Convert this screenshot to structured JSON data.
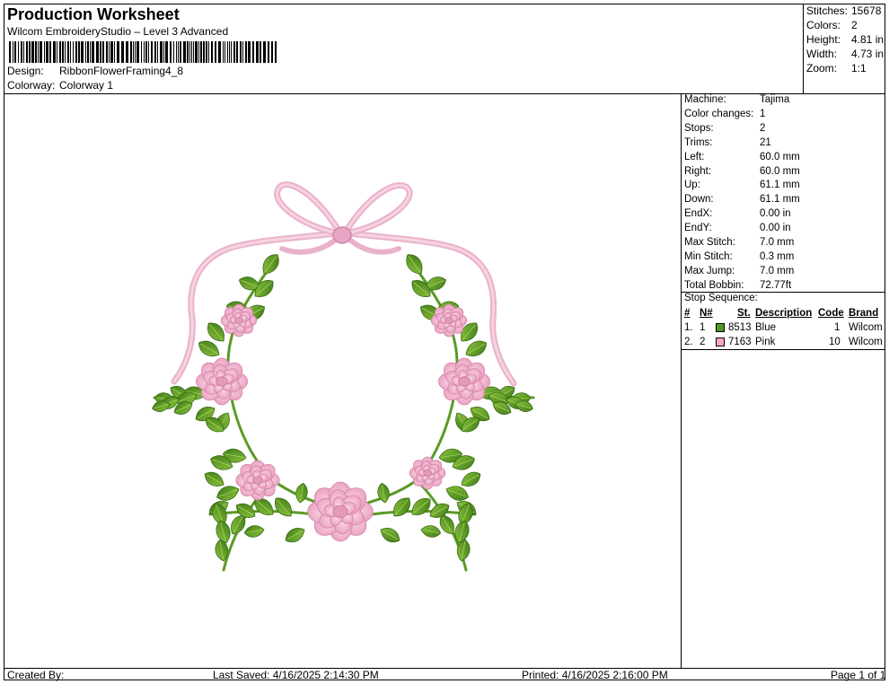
{
  "header": {
    "title": "Production Worksheet",
    "subtitle": "Wilcom EmbroideryStudio – Level 3 Advanced",
    "design_label": "Design:",
    "design_value": "RibbonFlowerFraming4_8",
    "colorway_label": "Colorway:",
    "colorway_value": "Colorway 1"
  },
  "stats": [
    {
      "label": "Stitches:",
      "value": "15678"
    },
    {
      "label": "Colors:",
      "value": "2"
    },
    {
      "label": "Height:",
      "value": "4.81 in"
    },
    {
      "label": "Width:",
      "value": "4.73 in"
    },
    {
      "label": "Zoom:",
      "value": "1:1"
    }
  ],
  "machine_info": [
    {
      "label": "Machine:",
      "value": "Tajima"
    },
    {
      "label": "Color changes:",
      "value": "1"
    },
    {
      "label": "Stops:",
      "value": "2"
    },
    {
      "label": "Trims:",
      "value": "21"
    },
    {
      "label": "Left:",
      "value": "60.0 mm"
    },
    {
      "label": "Right:",
      "value": "60.0 mm"
    },
    {
      "label": "Up:",
      "value": "61.1 mm"
    },
    {
      "label": "Down:",
      "value": "61.1 mm"
    },
    {
      "label": "EndX:",
      "value": "0.00 in"
    },
    {
      "label": "EndY:",
      "value": "0.00 in"
    },
    {
      "label": "Max Stitch:",
      "value": "7.0 mm"
    },
    {
      "label": "Min Stitch:",
      "value": "0.3 mm"
    },
    {
      "label": "Max Jump:",
      "value": "7.0 mm"
    },
    {
      "label": "Total Bobbin:",
      "value": "72.77ft"
    }
  ],
  "stop_sequence": {
    "label": "Stop Sequence:",
    "headers": {
      "num": "#",
      "n": "N#",
      "st": "St.",
      "desc": "Description",
      "code": "Code",
      "brand": "Brand"
    },
    "rows": [
      {
        "num": "1.",
        "n": "1",
        "color": "#4a9a1e",
        "st": "8513",
        "desc": "Blue",
        "code": "1",
        "brand": "Wilcom"
      },
      {
        "num": "2.",
        "n": "2",
        "color": "#f4a6c4",
        "st": "7163",
        "desc": "Pink",
        "code": "10",
        "brand": "Wilcom"
      }
    ]
  },
  "footer": {
    "created_by": "Created By:",
    "last_saved": "Last Saved: 4/16/2025 2:14:30 PM",
    "printed": "Printed: 4/16/2025 2:16:00 PM",
    "page": "Page 1 of 1"
  },
  "colors": {
    "leaf": "#5fa32c",
    "leaf_dark": "#3f7a18",
    "petal": "#f2b4cf",
    "petal_dark": "#d98aae",
    "ribbon": "#f0b8d1"
  }
}
